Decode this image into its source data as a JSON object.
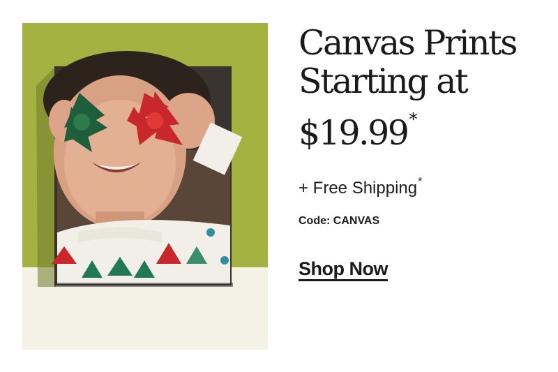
{
  "promo": {
    "headline_line1": "Canvas Prints",
    "headline_line2": "Starting at",
    "headline_price": "$19.99",
    "headline_asterisk": "*",
    "shipping_text": "+ Free Shipping",
    "shipping_asterisk": "*",
    "code_text": "Code: CANVAS",
    "cta_label": "Shop Now"
  },
  "colors": {
    "wall": "#9fae3e",
    "shelf": "#f4f2e6",
    "text": "#1c1c1c"
  },
  "image": {
    "subject": "canvas print photo of child holding green and red gift bows over eyes"
  }
}
